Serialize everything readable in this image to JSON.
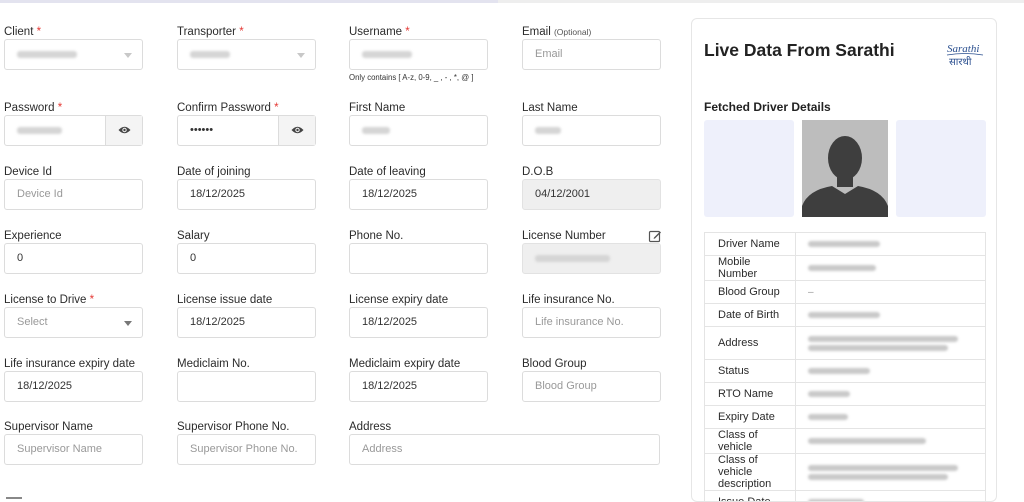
{
  "fields": [
    {
      "id": "client",
      "label": "Client",
      "required": true,
      "type": "select",
      "value": "",
      "obscured": true
    },
    {
      "id": "transporter",
      "label": "Transporter",
      "required": true,
      "type": "select",
      "value": "",
      "obscured": true
    },
    {
      "id": "username",
      "label": "Username",
      "required": true,
      "type": "text",
      "value": "",
      "obscured": true,
      "hint": "Only contains [ A-z, 0-9, _ , - , *, @ ]"
    },
    {
      "id": "email",
      "label": "Email",
      "optional": "(Optional)",
      "type": "text",
      "placeholder": "Email"
    },
    {
      "id": "password",
      "label": "Password",
      "required": true,
      "type": "password",
      "value": "",
      "obscured": true
    },
    {
      "id": "confirm_password",
      "label": "Confirm Password",
      "required": true,
      "type": "password",
      "value": "••••••"
    },
    {
      "id": "first_name",
      "label": "First Name",
      "type": "text",
      "value": "",
      "obscured": true
    },
    {
      "id": "last_name",
      "label": "Last Name",
      "type": "text",
      "value": "",
      "obscured": true
    },
    {
      "id": "device_id",
      "label": "Device Id",
      "type": "text",
      "placeholder": "Device Id"
    },
    {
      "id": "date_of_joining",
      "label": "Date of joining",
      "type": "date",
      "value": "18/12/2025"
    },
    {
      "id": "date_of_leaving",
      "label": "Date of leaving",
      "type": "date",
      "value": "18/12/2025"
    },
    {
      "id": "dob",
      "label": "D.O.B",
      "type": "date",
      "value": "04/12/2001",
      "disabled": true
    },
    {
      "id": "experience",
      "label": "Experience",
      "type": "number",
      "value": "0"
    },
    {
      "id": "salary",
      "label": "Salary",
      "type": "number",
      "value": "0"
    },
    {
      "id": "phone_no",
      "label": "Phone No.",
      "type": "text",
      "value": ""
    },
    {
      "id": "license_number",
      "label": "License Number",
      "type": "text",
      "value": "",
      "obscured": true,
      "disabled": true
    },
    {
      "id": "license_to_drive",
      "label": "License to Drive",
      "required": true,
      "type": "select",
      "placeholder": "Select"
    },
    {
      "id": "license_issue_date",
      "label": "License issue date",
      "type": "date",
      "value": "18/12/2025"
    },
    {
      "id": "license_expiry_date",
      "label": "License expiry date",
      "type": "date",
      "value": "18/12/2025"
    },
    {
      "id": "life_insurance_no",
      "label": "Life insurance No.",
      "type": "text",
      "placeholder": "Life insurance No."
    },
    {
      "id": "life_insurance_expiry_date",
      "label": "Life insurance expiry date",
      "type": "date",
      "value": "18/12/2025"
    },
    {
      "id": "mediclaim_no",
      "label": "Mediclaim No.",
      "type": "text",
      "value": ""
    },
    {
      "id": "mediclaim_expiry_date",
      "label": "Mediclaim expiry date",
      "type": "date",
      "value": "18/12/2025"
    },
    {
      "id": "blood_group",
      "label": "Blood Group",
      "type": "text",
      "placeholder": "Blood Group"
    },
    {
      "id": "supervisor_name",
      "label": "Supervisor Name",
      "type": "text",
      "placeholder": "Supervisor Name"
    },
    {
      "id": "supervisor_phone",
      "label": "Supervisor Phone No.",
      "type": "text",
      "placeholder": "Supervisor Phone No."
    },
    {
      "id": "address",
      "label": "Address",
      "type": "text",
      "placeholder": "Address"
    }
  ],
  "panel": {
    "title": "Live Data From Sarathi",
    "logo_text_top": "Sarathi",
    "logo_text_bottom": "सारथी",
    "fetched_title": "Fetched Driver Details",
    "rows": [
      {
        "label": "Driver Name",
        "obscured": true
      },
      {
        "label": "Mobile Number",
        "obscured": true
      },
      {
        "label": "Blood Group",
        "value": "–"
      },
      {
        "label": "Date of Birth",
        "obscured": true
      },
      {
        "label": "Address",
        "obscured": true,
        "lines": 2
      },
      {
        "label": "Status",
        "obscured": true
      },
      {
        "label": "RTO Name",
        "obscured": true
      },
      {
        "label": "Expiry Date",
        "obscured": true
      },
      {
        "label": "Class of vehicle",
        "obscured": true
      },
      {
        "label": "Class of vehicle description",
        "obscured": true,
        "lines": 2
      },
      {
        "label": "Issue Date",
        "obscured": true
      }
    ]
  },
  "colors": {
    "required_asterisk": "#e53935",
    "photo_background": "#bdbdbd",
    "photo_panel": "#eef0fb",
    "logo_blue": "#2a4f8f"
  }
}
